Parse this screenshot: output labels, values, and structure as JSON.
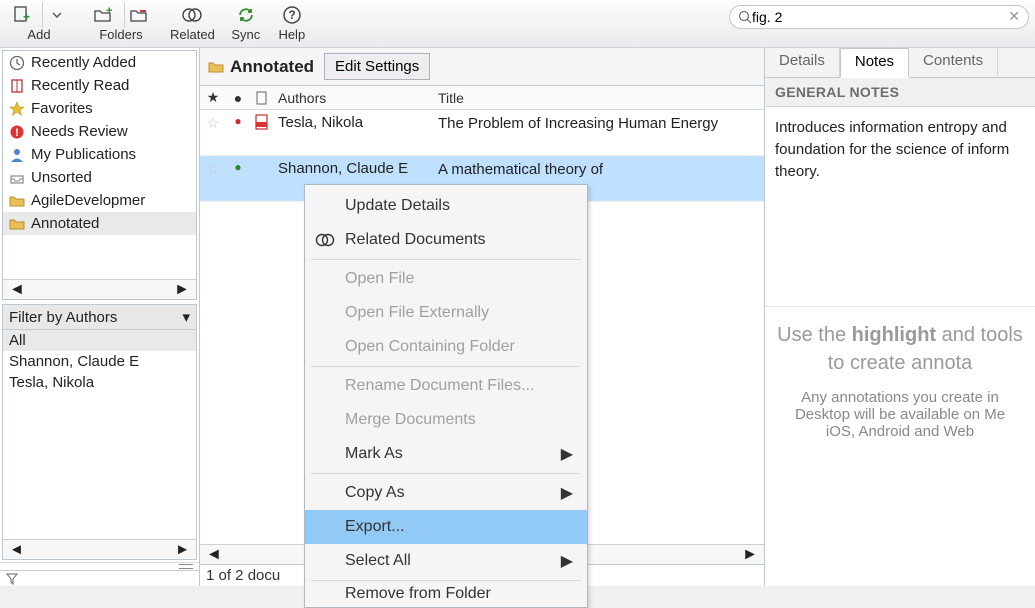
{
  "toolbar": {
    "add_label": "Add",
    "folders_label": "Folders",
    "related_label": "Related",
    "sync_label": "Sync",
    "help_label": "Help"
  },
  "search": {
    "value": "fig. 2"
  },
  "sidebar": {
    "items": [
      {
        "label": "Recently Added",
        "icon": "clock"
      },
      {
        "label": "Recently Read",
        "icon": "book"
      },
      {
        "label": "Favorites",
        "icon": "star"
      },
      {
        "label": "Needs Review",
        "icon": "alert"
      },
      {
        "label": "My Publications",
        "icon": "person"
      },
      {
        "label": "Unsorted",
        "icon": "tray"
      },
      {
        "label": "AgileDevelopmer",
        "icon": "folder"
      },
      {
        "label": "Annotated",
        "icon": "folder",
        "selected": true
      }
    ]
  },
  "filter": {
    "header": "Filter by Authors",
    "items": [
      "All",
      "Shannon, Claude E",
      "Tesla, Nikola"
    ]
  },
  "center": {
    "title": "Annotated",
    "edit_settings": "Edit Settings",
    "columns": {
      "authors": "Authors",
      "title": "Title"
    },
    "rows": [
      {
        "authors": "Tesla, Nikola",
        "title": "The Problem of Increasing Human Energy",
        "doc": "pdf",
        "dot": "red",
        "selected": false
      },
      {
        "authors": "Shannon, Claude E",
        "title": "A mathematical theory of",
        "doc": "",
        "dot": "green",
        "selected": true
      }
    ],
    "status": "1 of 2 docu"
  },
  "right": {
    "tabs": {
      "details": "Details",
      "notes": "Notes",
      "contents": "Contents",
      "active": "notes"
    },
    "section": "GENERAL NOTES",
    "notes_text": "Introduces information entropy and foundation for the science of inform theory.",
    "hint_big_pre": "Use the ",
    "hint_big_bold": "highlight",
    "hint_big_post": " and tools to create annota",
    "hint_small1": "Any annotations you create in",
    "hint_small2": "Desktop will be available on Me",
    "hint_small3": "iOS, Android and Web"
  },
  "context_menu": {
    "items": [
      {
        "label": "Update Details",
        "enabled": true
      },
      {
        "label": "Related Documents",
        "enabled": true,
        "icon": "related"
      },
      {
        "sep": true
      },
      {
        "label": "Open File",
        "enabled": false
      },
      {
        "label": "Open File Externally",
        "enabled": false
      },
      {
        "label": "Open Containing Folder",
        "enabled": false
      },
      {
        "sep": true
      },
      {
        "label": "Rename Document Files...",
        "enabled": false
      },
      {
        "label": "Merge Documents",
        "enabled": false
      },
      {
        "label": "Mark As",
        "enabled": true,
        "submenu": true
      },
      {
        "sep": true
      },
      {
        "label": "Copy As",
        "enabled": true,
        "submenu": true
      },
      {
        "label": "Export...",
        "enabled": true,
        "highlight": true
      },
      {
        "label": "Select All",
        "enabled": true,
        "submenu": true
      },
      {
        "sep": true
      },
      {
        "label": "Remove from Folder",
        "enabled": true,
        "clipped": true
      }
    ]
  }
}
